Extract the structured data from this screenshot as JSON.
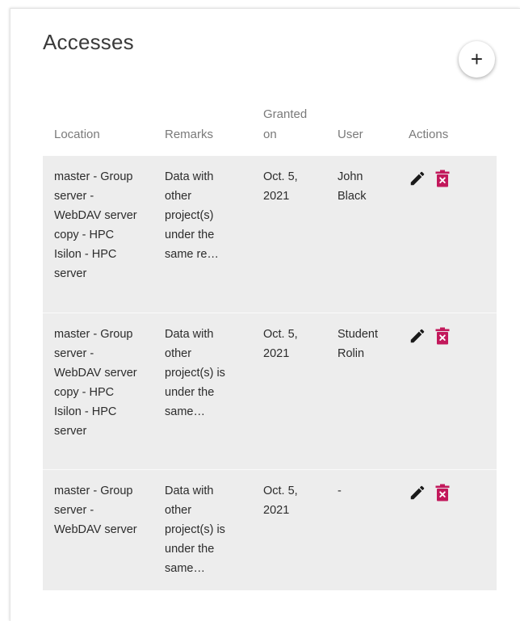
{
  "card": {
    "title": "Accesses",
    "add_label": "+"
  },
  "table": {
    "headers": {
      "location": "Location",
      "remarks": "Remarks",
      "granted_on": "Granted on",
      "user": "User",
      "actions": "Actions"
    },
    "rows": [
      {
        "location": "master - Group server - WebDAV server copy - HPC Isilon - HPC server",
        "remarks": "Data with other project(s) under the same re…",
        "granted_on": "Oct. 5, 2021",
        "user": "John Black"
      },
      {
        "location": "master - Group server - WebDAV server copy - HPC Isilon - HPC server",
        "remarks": "Data with other project(s) is under the same…",
        "granted_on": "Oct. 5, 2021",
        "user": "Student Rolin"
      },
      {
        "location": "master - Group server - WebDAV server",
        "remarks": "Data with other project(s) is under the same…",
        "granted_on": "Oct. 5, 2021",
        "user": "-"
      }
    ]
  },
  "icons": {
    "edit": "pencil-icon",
    "delete": "trash-x-icon"
  },
  "colors": {
    "delete": "#c2185b",
    "edit": "#1a1a1a",
    "row_background": "#ededed"
  }
}
